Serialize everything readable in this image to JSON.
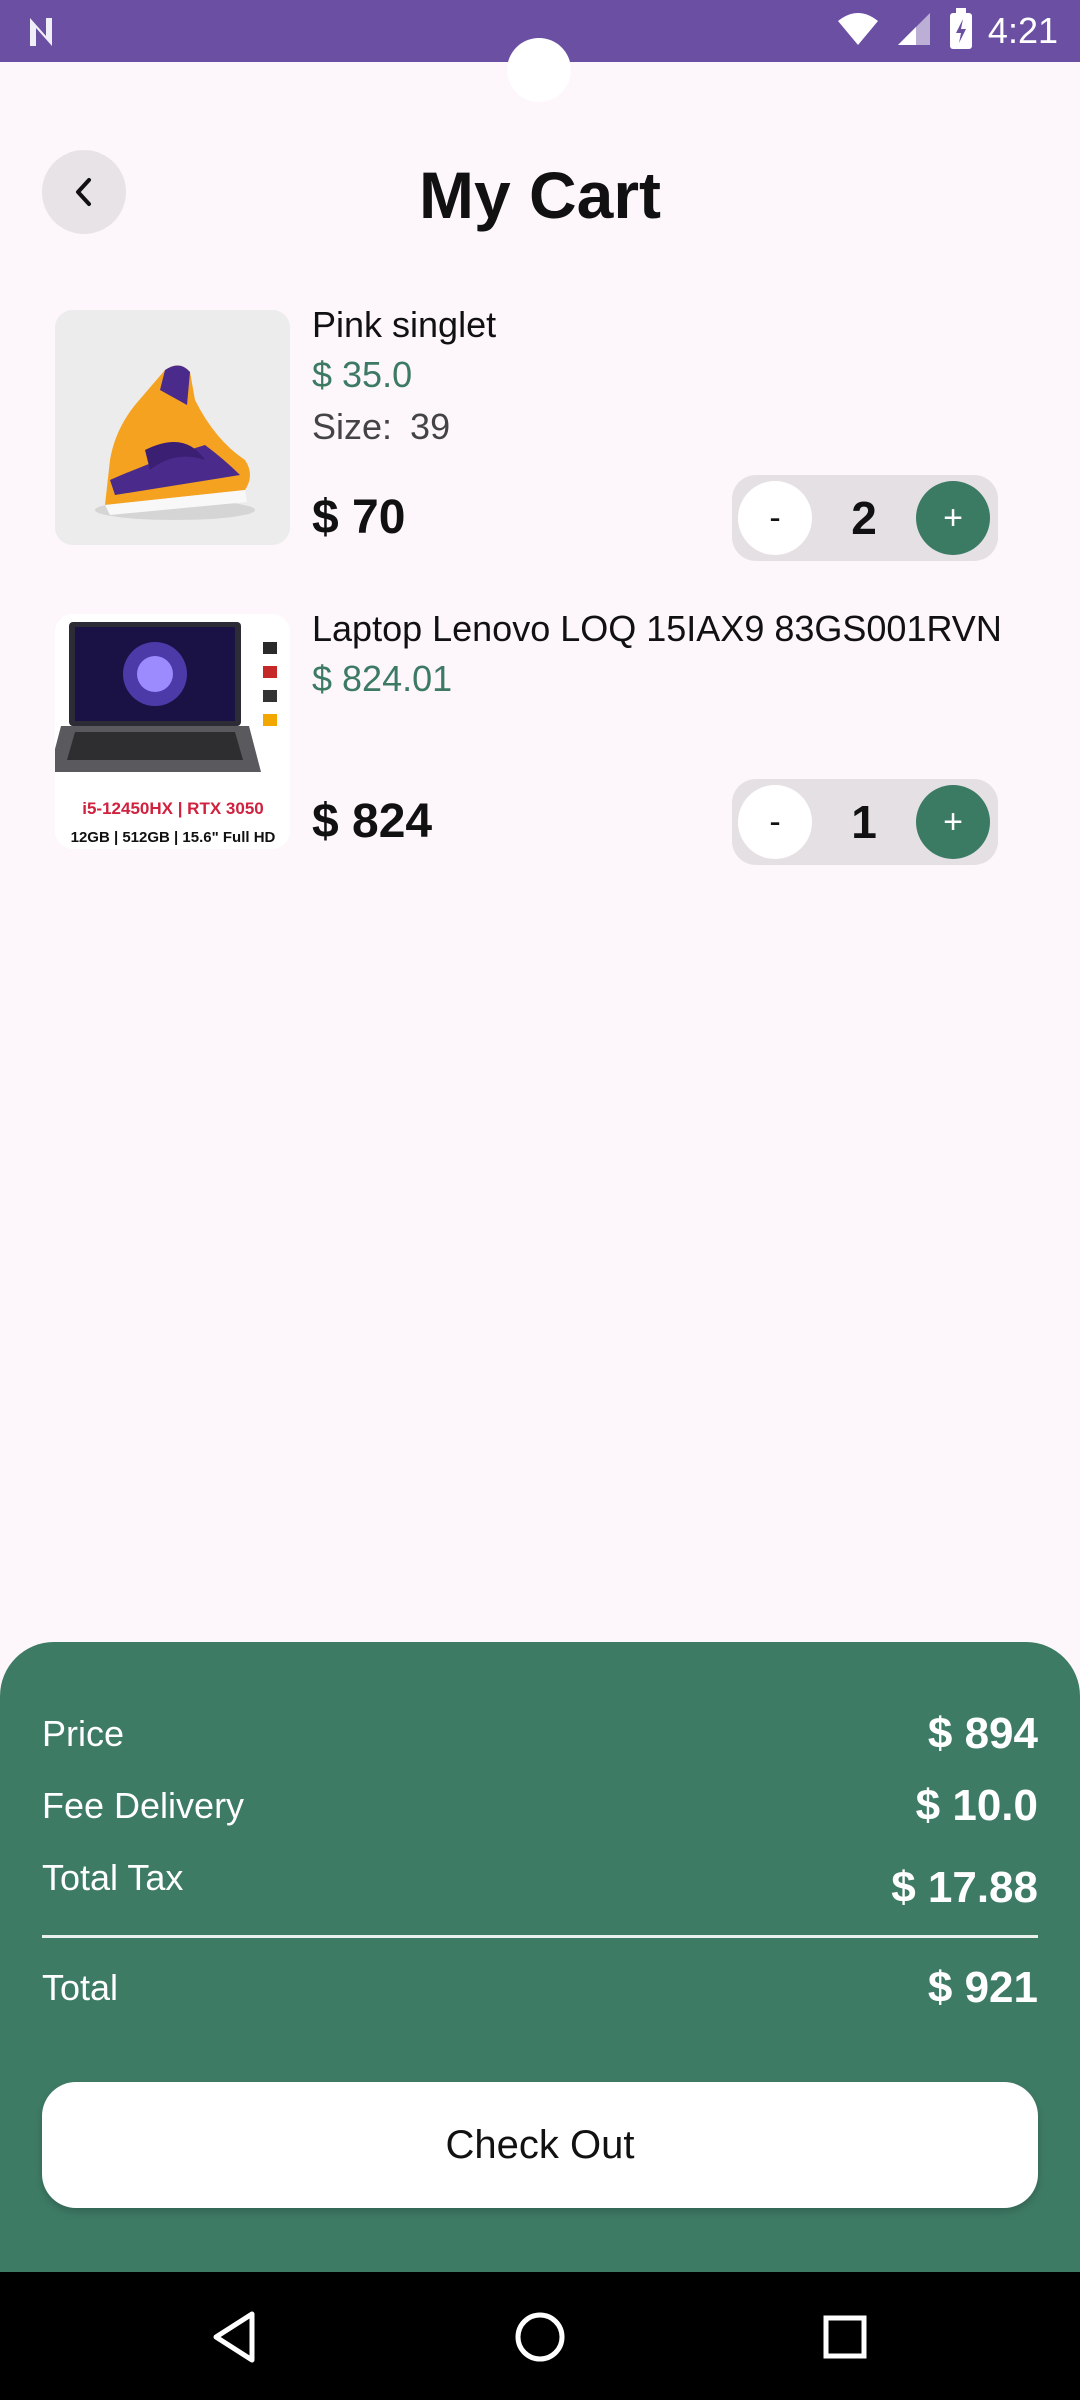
{
  "status_bar": {
    "time": "4:21"
  },
  "header": {
    "title": "My Cart"
  },
  "cart": {
    "items": [
      {
        "name": "Pink singlet",
        "unit_price": "$ 35.0",
        "size_label": "Size:",
        "size_value": "39",
        "total": "$ 70",
        "quantity": "2",
        "minus_label": "-",
        "plus_label": "+"
      },
      {
        "name": "Laptop Lenovo LOQ 15IAX9 83GS001RVN",
        "unit_price": "$ 824.01",
        "total": "$ 824",
        "quantity": "1",
        "minus_label": "-",
        "plus_label": "+",
        "image_text": {
          "specs_top": "i5-12450HX | RTX 3050",
          "specs_bottom": "12GB | 512GB | 15.6\" Full HD"
        }
      }
    ]
  },
  "summary": {
    "price_label": "Price",
    "price_value": "$ 894",
    "delivery_label": "Fee Delivery",
    "delivery_value": "$ 10.0",
    "tax_label": "Total Tax",
    "tax_value": "$ 17.88",
    "total_label": "Total",
    "total_value": "$ 921",
    "checkout_label": "Check Out"
  },
  "colors": {
    "accent": "#3e7b65",
    "status_bar": "#6a4fa3",
    "background": "#fdf6fb"
  },
  "icons": {
    "back": "chevron-left-icon",
    "nav_back": "triangle-back-icon",
    "nav_home": "circle-home-icon",
    "nav_recents": "square-recents-icon"
  }
}
